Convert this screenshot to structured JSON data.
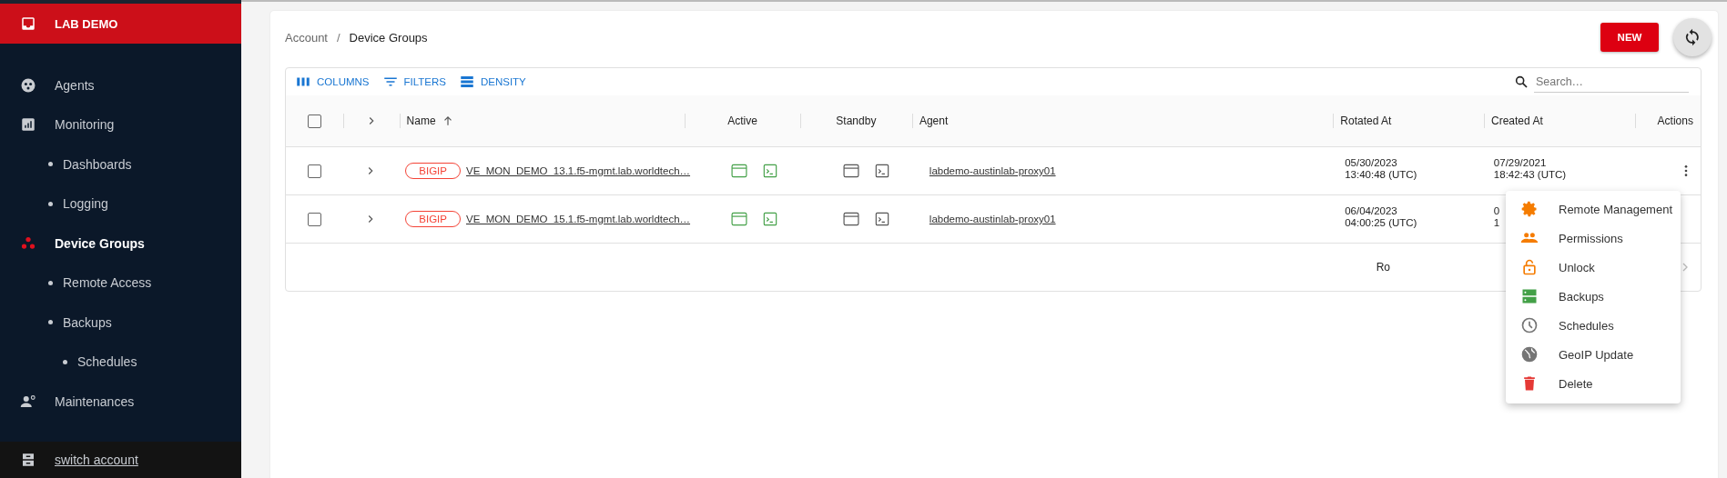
{
  "sidebar": {
    "brand": "LAB DEMO",
    "items": [
      {
        "label": "Agents",
        "selected": false
      },
      {
        "label": "Monitoring",
        "selected": false,
        "children": [
          {
            "label": "Dashboards",
            "selected": false
          },
          {
            "label": "Logging",
            "selected": false
          }
        ]
      },
      {
        "label": "Device Groups",
        "selected": true,
        "children": [
          {
            "label": "Remote Access",
            "selected": false
          },
          {
            "label": "Backups",
            "selected": false,
            "children": [
              {
                "label": "Schedules",
                "selected": false
              }
            ]
          }
        ]
      },
      {
        "label": "Maintenances",
        "selected": false
      }
    ],
    "footer": "switch account"
  },
  "breadcrumb": [
    "Account",
    "Device Groups"
  ],
  "breadcrumb_separator": "/",
  "new_button": "NEW",
  "toolbar": {
    "buttons": [
      "COLUMNS",
      "FILTERS",
      "DENSITY"
    ],
    "search": {
      "placeholder": "Search…"
    }
  },
  "table": {
    "all_selected": false,
    "columns": [
      "Name",
      "Active",
      "Standby",
      "Agent",
      "Rotated At",
      "Created At",
      "Actions"
    ],
    "rows": [
      {
        "selected": false,
        "tag": "BIGIP",
        "name": "VE_MON_DEMO_13.1.f5-mgmt.lab.worldtech…",
        "active_up": true,
        "standby_up": false,
        "agent": "labdemo-austinlab-proxy01",
        "rotated": [
          "05/30/2023",
          "13:40:48 (UTC)"
        ],
        "created": [
          "07/29/2021",
          "18:42:43 (UTC)"
        ],
        "kebab": true
      },
      {
        "selected": false,
        "tag": "BIGIP",
        "name": "VE_MON_DEMO_15.1.f5-mgmt.lab.worldtech…",
        "active_up": true,
        "standby_up": false,
        "agent": "labdemo-austinlab-proxy01",
        "rotated": [
          "06/04/2023",
          "04:00:25 (UTC)"
        ],
        "created": [
          "0",
          "1"
        ],
        "kebab": false
      }
    ],
    "footer": "Ro"
  },
  "menu": [
    {
      "label": "Remote Management",
      "color": "#f57c00"
    },
    {
      "label": "Permissions",
      "color": "#f57c00"
    },
    {
      "label": "Unlock",
      "color": "#f57c00"
    },
    {
      "label": "Backups",
      "color": "#43a047"
    },
    {
      "label": "Schedules",
      "color": "#757575"
    },
    {
      "label": "GeoIP Update",
      "color": "#757575"
    },
    {
      "label": "Delete",
      "color": "#e53935"
    }
  ]
}
